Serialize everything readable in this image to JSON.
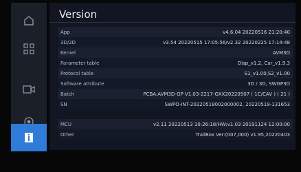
{
  "page_title": "Version",
  "sidebar": {
    "items": [
      {
        "icon": "home-icon",
        "active": false
      },
      {
        "icon": "grid-icon",
        "active": false
      },
      {
        "icon": "camera-icon",
        "active": false
      },
      {
        "icon": "eye-icon",
        "active": false
      },
      {
        "icon": "info-icon",
        "active": true
      }
    ]
  },
  "version_table": [
    {
      "key": "App",
      "value": "v4.6.04 20220516 21:20:40"
    },
    {
      "key": "3D/2D",
      "value": "v3.54 20220515 17:05:56/v2.32 20220225 17:14:48"
    },
    {
      "key": "Kernel",
      "value": "AVM3D"
    },
    {
      "key": "Parameter table",
      "value": "Disp_v1.2, Car_v1.9.3"
    },
    {
      "key": "Protocol table",
      "value": "S1_v1.00,S2_v1.00"
    },
    {
      "key": "Software attribute",
      "value": "3D / 3D, SWGP3D"
    },
    {
      "key": "Batch",
      "value": "PCBA:AVM3D-GP V1.03-2217-GXX20220507 ( 1C/CAV ) ( 21 )"
    },
    {
      "key": "SN",
      "value": "SWPO-INT-20220518002000002, 20220519-131653"
    }
  ],
  "mcu_table": [
    {
      "key": "MCU",
      "value": "v2.11 20220513 10:26:18/HW:v1.03 20191124 12:00:00"
    },
    {
      "key": "Other",
      "value": "TrailBox Ver:(007,000) v1.95,20220403"
    }
  ],
  "colors": {
    "accent": "#2f7bd8",
    "sidebar_bg": "#1b2028",
    "content_bg": "#111622"
  }
}
